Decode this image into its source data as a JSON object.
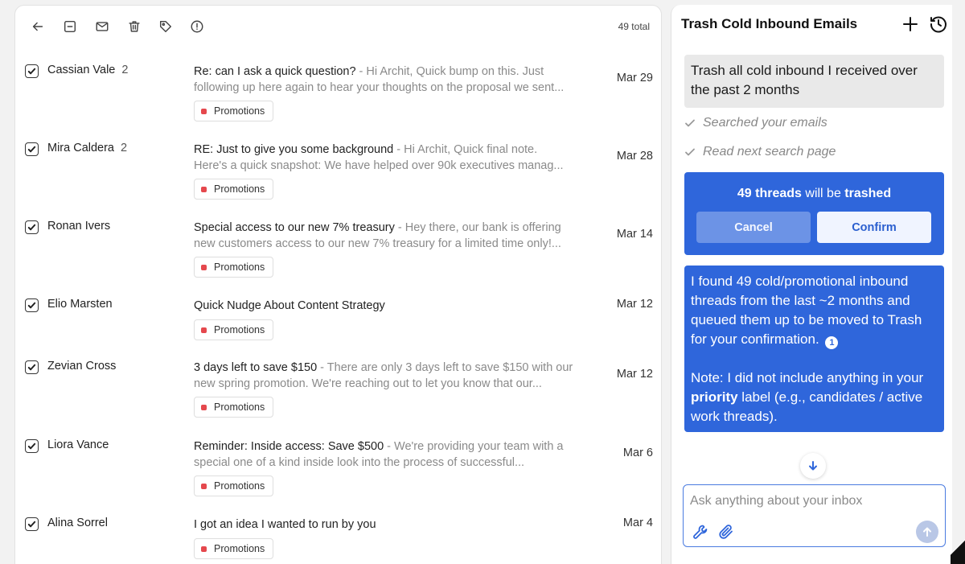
{
  "toolbar": {
    "icons": [
      "back-arrow-icon",
      "archive-icon",
      "mail-icon",
      "trash-icon",
      "tag-icon",
      "alert-icon"
    ],
    "total": "49 total"
  },
  "emails": [
    {
      "sender": "Cassian Vale",
      "count": "2",
      "subject": "Re: can I ask a quick question?",
      "separator": " - ",
      "snippet": "Hi Archit, Quick bump on this. Just following up here again to hear your thoughts on the proposal we sent...",
      "date": "Mar 29",
      "label": "Promotions"
    },
    {
      "sender": "Mira Caldera",
      "count": "2",
      "subject": "RE: Just to give you some background",
      "separator": " - ",
      "snippet": "Hi Archit, Quick final note. Here's a quick snapshot: We have helped over 90k executives manag...",
      "date": "Mar 28",
      "label": "Promotions"
    },
    {
      "sender": "Ronan Ivers",
      "count": "",
      "subject": "Special access to our new 7% treasury",
      "separator": " - ",
      "snippet": "Hey there, our bank is offering new customers access to our new 7% treasury for a limited time only!...",
      "date": "Mar 14",
      "label": "Promotions"
    },
    {
      "sender": "Elio Marsten",
      "count": "",
      "subject": "Quick Nudge About Content Strategy",
      "separator": "",
      "snippet": "",
      "date": "Mar 12",
      "label": "Promotions"
    },
    {
      "sender": "Zevian Cross",
      "count": "",
      "subject": "3 days left to save $150",
      "separator": " - ",
      "snippet": "There are only 3 days left to save $150 with our new spring promotion. We're reaching out to let you know that our...",
      "date": "Mar 12",
      "label": "Promotions"
    },
    {
      "sender": "Liora Vance",
      "count": "",
      "subject": "Reminder: Inside access: Save $500",
      "separator": " - ",
      "snippet": "We're providing your team with a special one of a kind inside look into the process of successful...",
      "date": "Mar 6",
      "label": "Promotions"
    },
    {
      "sender": "Alina Sorrel",
      "count": "",
      "subject": "I got an idea I wanted to run by you",
      "separator": "",
      "snippet": "",
      "date": "Mar 4",
      "label": "Promotions"
    }
  ],
  "assistant": {
    "title": "Trash Cold Inbound Emails",
    "user_message": "Trash all cold inbound I received over the past 2 months",
    "steps": [
      "Searched your emails",
      "Read next search page"
    ],
    "confirm": {
      "count_text": "49 threads",
      "rest_text": " will be ",
      "action_text": "trashed",
      "cancel": "Cancel",
      "confirm": "Confirm"
    },
    "reply": {
      "paragraph1": "I found 49 cold/promotional inbound threads from the last ~2 months and queued them up to be moved to Trash for your confirmation.",
      "citation": "1",
      "note_prefix": "Note: I did not include anything in your ",
      "note_bold": "priority",
      "note_suffix": " label (e.g., candidates / active work threads)."
    },
    "input_placeholder": "Ask anything about your inbox"
  },
  "colors": {
    "accent": "#2f66db",
    "label_dot": "#e5484d"
  }
}
